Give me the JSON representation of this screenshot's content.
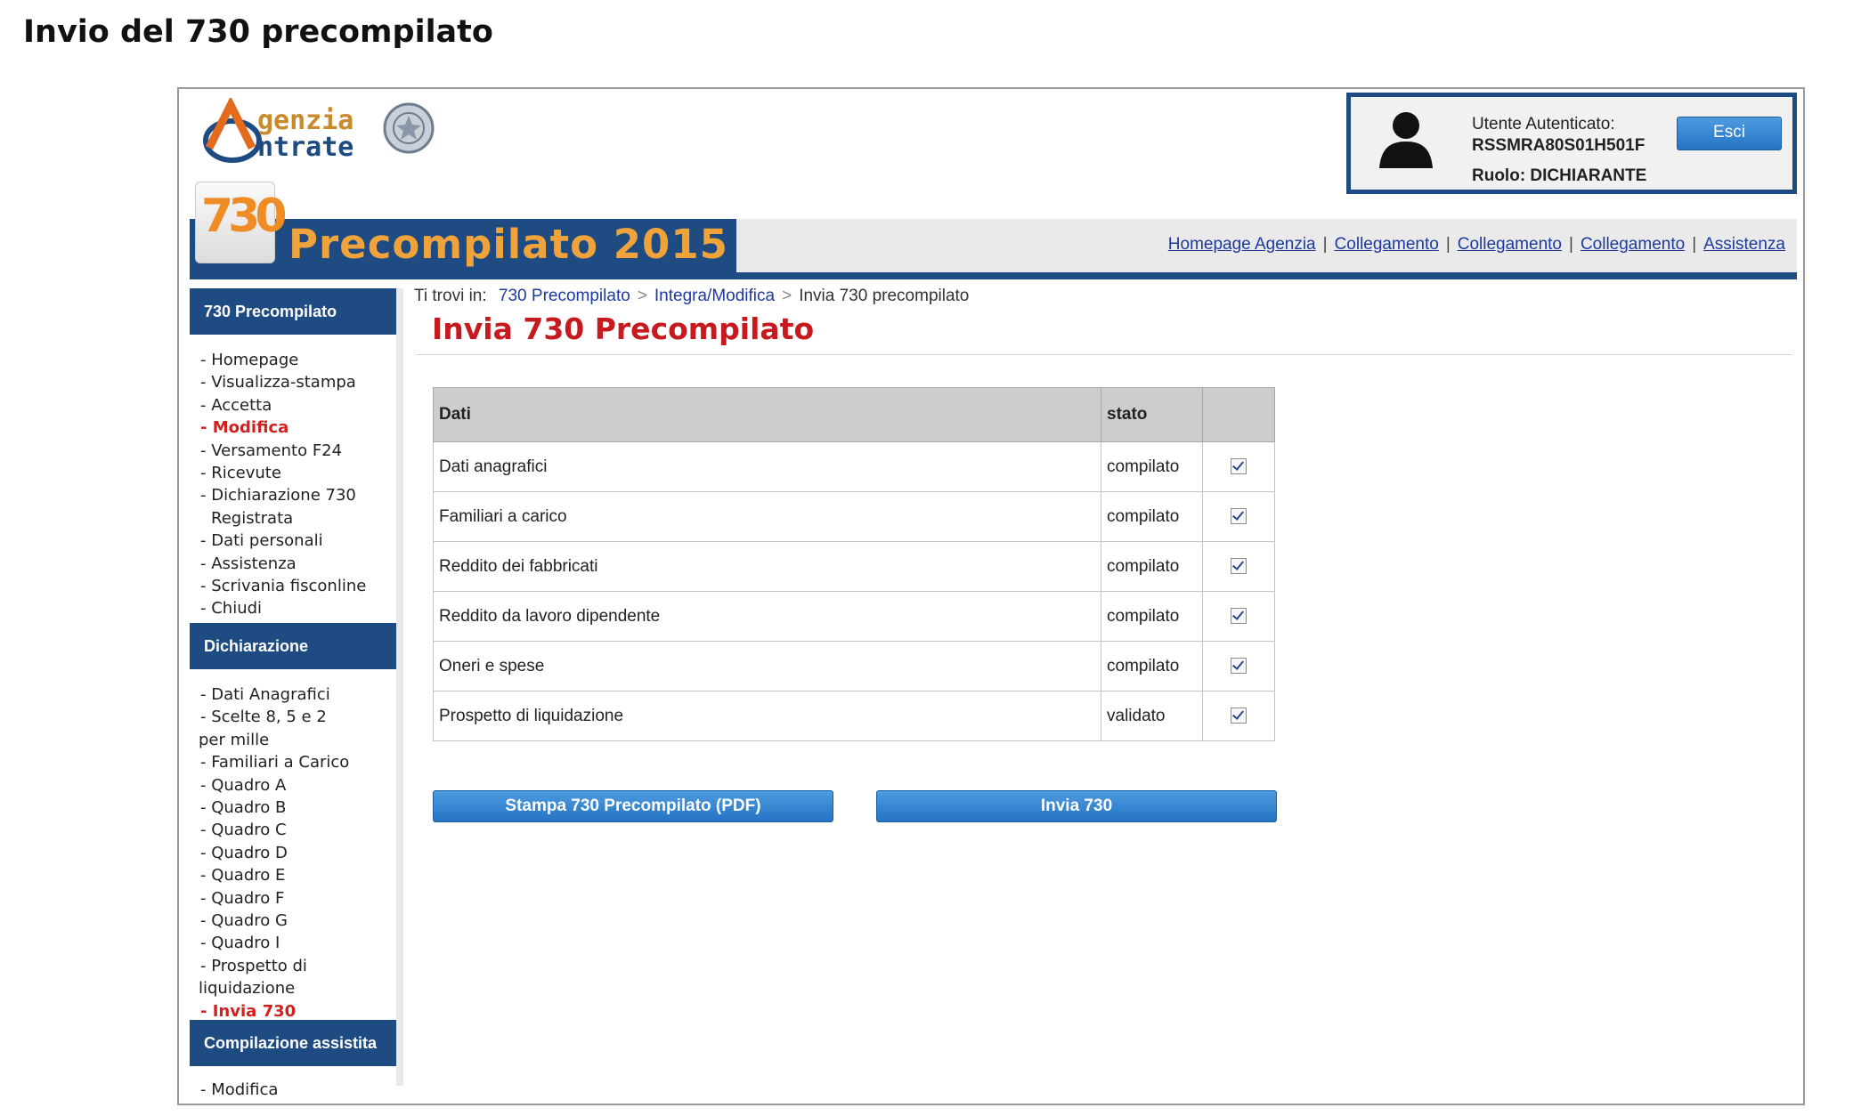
{
  "document_title": "Invio del 730 precompilato",
  "header": {
    "logo_text_line1": "genzia",
    "logo_text_line2": "ntrate",
    "logo_letter_a": "A",
    "logo_letter_e": "e",
    "badge_text": "730",
    "banner_title": "Precompilato 2015",
    "user": {
      "label": "Utente Autenticato:",
      "code": "RSSMRA80S01H501F",
      "role": "Ruolo: DICHIARANTE",
      "logout_label": "Esci"
    },
    "links": [
      "Homepage Agenzia",
      "Collegamento",
      "Collegamento",
      "Collegamento",
      "Assistenza"
    ]
  },
  "sidebar": {
    "sections": [
      {
        "title": "730 Precompilato",
        "items": [
          {
            "label": "- Homepage"
          },
          {
            "label": "- Visualizza-stampa"
          },
          {
            "label": "- Accetta"
          },
          {
            "label": "- Modifica",
            "active": true
          },
          {
            "label": "- Versamento F24"
          },
          {
            "label": "- Ricevute"
          },
          {
            "label": "- Dichiarazione 730"
          },
          {
            "label": "Registrata"
          },
          {
            "label": "- Dati personali"
          },
          {
            "label": "- Assistenza"
          },
          {
            "label": "- Scrivania fisconline"
          },
          {
            "label": "- Chiudi"
          }
        ]
      },
      {
        "title": "Dichiarazione",
        "items": [
          {
            "label": "- Dati Anagrafici"
          },
          {
            "label": "- Scelte 8, 5 e 2"
          },
          {
            "label": "per mille"
          },
          {
            "label": "- Familiari a Carico"
          },
          {
            "label": "- Quadro A"
          },
          {
            "label": "- Quadro B"
          },
          {
            "label": "- Quadro C"
          },
          {
            "label": "- Quadro D"
          },
          {
            "label": "- Quadro E"
          },
          {
            "label": "- Quadro F"
          },
          {
            "label": "- Quadro G"
          },
          {
            "label": "- Quadro I"
          },
          {
            "label": "- Prospetto di"
          },
          {
            "label": "liquidazione"
          },
          {
            "label": "- Invia 730",
            "active": true
          }
        ]
      },
      {
        "title": "Compilazione assistita",
        "items": [
          {
            "label": "- Modifica"
          }
        ]
      }
    ]
  },
  "breadcrumb": {
    "prefix": "Ti trovi in:",
    "items": [
      "730 Precompilato",
      "Integra/Modifica",
      "Invia 730 precompilato"
    ],
    "separator": ">"
  },
  "page_title": "Invia 730 Precompilato",
  "table": {
    "headers": [
      "Dati",
      "stato",
      ""
    ],
    "rows": [
      {
        "dati": "Dati anagrafici",
        "stato": "compilato",
        "checked": true
      },
      {
        "dati": "Familiari a carico",
        "stato": "compilato",
        "checked": true
      },
      {
        "dati": "Reddito dei fabbricati",
        "stato": "compilato",
        "checked": true
      },
      {
        "dati": "Reddito da lavoro dipendente",
        "stato": "compilato",
        "checked": true
      },
      {
        "dati": "Oneri e spese",
        "stato": "compilato",
        "checked": true
      },
      {
        "dati": "Prospetto di liquidazione",
        "stato": "validato",
        "checked": true
      }
    ]
  },
  "actions": {
    "print_label": "Stampa 730 Precompilato (PDF)",
    "send_label": "Invia 730"
  },
  "colors": {
    "brand_blue": "#1d4b82",
    "accent_orange": "#f0a33a",
    "title_red": "#c8191e",
    "button_blue": "#2e82d0"
  }
}
